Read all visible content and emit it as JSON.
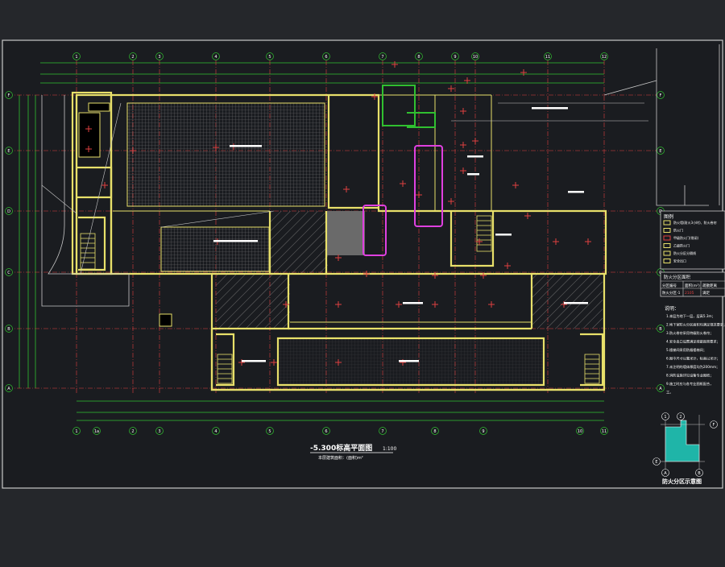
{
  "drawing": {
    "title": "-5.300标高平面图",
    "scale": "1:100",
    "subtitle": "本层建筑面积：(面积)m²"
  },
  "axes": {
    "top": [
      "1",
      "2",
      "3",
      "4",
      "5",
      "6",
      "7",
      "8",
      "9",
      "10",
      "11",
      "12"
    ],
    "bottom": [
      "1",
      "1a",
      "2",
      "3",
      "4",
      "5",
      "6",
      "7",
      "8",
      "9",
      "10",
      "11"
    ],
    "left": [
      "F",
      "E",
      "D",
      "C",
      "B",
      "A"
    ],
    "right": [
      "F",
      "E",
      "D",
      "C",
      "B",
      "A"
    ]
  },
  "legend": {
    "title": "图例",
    "items": [
      "防火墙(耐火3小时)、防火卷帘",
      "防火门",
      "甲级防火门(常闭)",
      "乙级防火门",
      "防火分区分隔线",
      "安全出口"
    ]
  },
  "area_table": {
    "title": "防火分区面积",
    "headers": [
      "分区编号",
      "面积(m²)",
      "疏散距离"
    ],
    "row": [
      "防火分区-1",
      "2105",
      "满足"
    ]
  },
  "notes": {
    "heading": "说明：",
    "lines": [
      "1.本层为地下一层，层高5.3m；",
      "2.地下室防火分区面积均满足规范要求；",
      "3.防火卷帘采用特级防火卷帘；",
      "4.安全出口设置满足疏散距离要求；",
      "5.楼梯间采用防烟楼梯间；",
      "6.图中尺寸以毫米计，标高以米计；",
      "7.未注明的墙体厚度均为200mm；",
      "8.消防设施详见设备专业图纸；",
      "9.施工时应与各专业图纸配合，",
      "工。"
    ]
  },
  "keyplan": {
    "title": "防火分区示意图",
    "labels": [
      "1",
      "2",
      "F",
      "E",
      "A",
      "B"
    ]
  },
  "colors": {
    "background": "#25272b",
    "paper": "#1a1c20",
    "wall": "#e8e06a",
    "axis": "#e04040",
    "green": "#30c030",
    "magenta": "#e040e0",
    "text": "#ffffff",
    "hatch": "#7a7a7a"
  }
}
